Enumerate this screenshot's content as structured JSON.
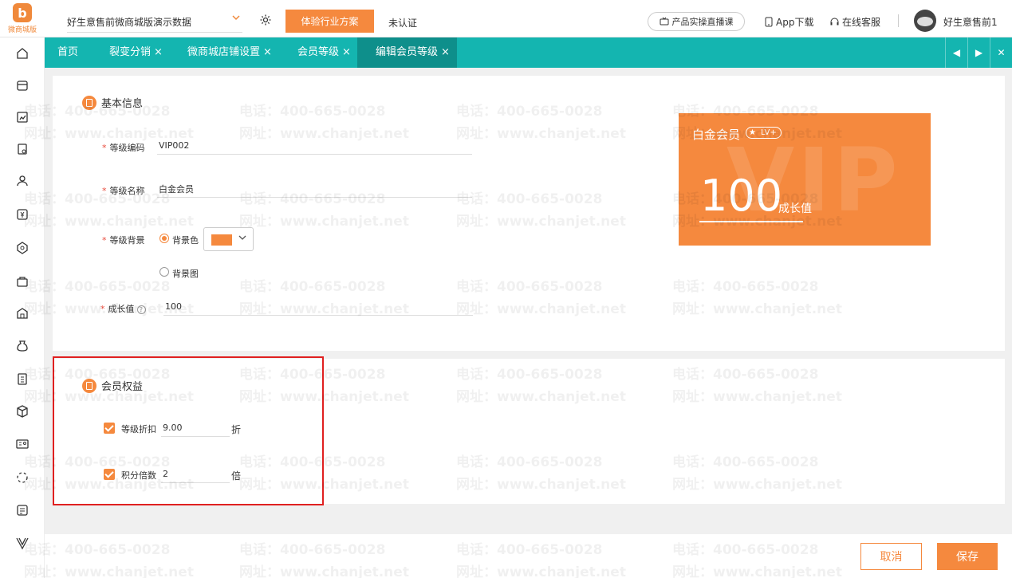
{
  "topbar": {
    "logo_mark": "b",
    "logo_text": "微商城版",
    "company": "好生意售前微商城版演示数据",
    "industry_btn": "体验行业方案",
    "auth_status": "未认证",
    "live_course": "产品实操直播课",
    "app_download": "App下载",
    "online_service": "在线客服",
    "username": "好生意售前1"
  },
  "tabs": [
    {
      "label": "首页",
      "closable": false
    },
    {
      "label": "裂变分销",
      "closable": true
    },
    {
      "label": "微商城店铺设置",
      "closable": true
    },
    {
      "label": "会员等级",
      "closable": true
    },
    {
      "label": "编辑会员等级",
      "closable": true,
      "active": true
    }
  ],
  "close_glyph": "×",
  "basic": {
    "title": "基本信息",
    "level_code_label": "等级编码",
    "level_code": "VIP002",
    "level_name_label": "等级名称",
    "level_name": "白金会员",
    "bg_label": "等级背景",
    "bg_color_option": "背景色",
    "bg_image_option": "背景图",
    "bg_color": "#f5893e",
    "growth_label": "成长值",
    "growth_value": "100"
  },
  "card": {
    "name": "白金会员",
    "badge": "LV+",
    "watermark": "VIP",
    "value": "100",
    "unit": "成长值"
  },
  "rights": {
    "title": "会员权益",
    "discount_label": "等级折扣",
    "discount_value": "9.00",
    "discount_unit": "折",
    "points_label": "积分倍数",
    "points_value": "2",
    "points_unit": "倍"
  },
  "footer": {
    "cancel": "取消",
    "save": "保存"
  },
  "watermark": {
    "phone": "电话：400-665-0028",
    "site": "网址：www.chanjet.net"
  },
  "colors": {
    "accent": "#f5893e",
    "teal": "#14b5b0",
    "teal_active": "#0e8f8b",
    "highlight": "#e02020"
  }
}
